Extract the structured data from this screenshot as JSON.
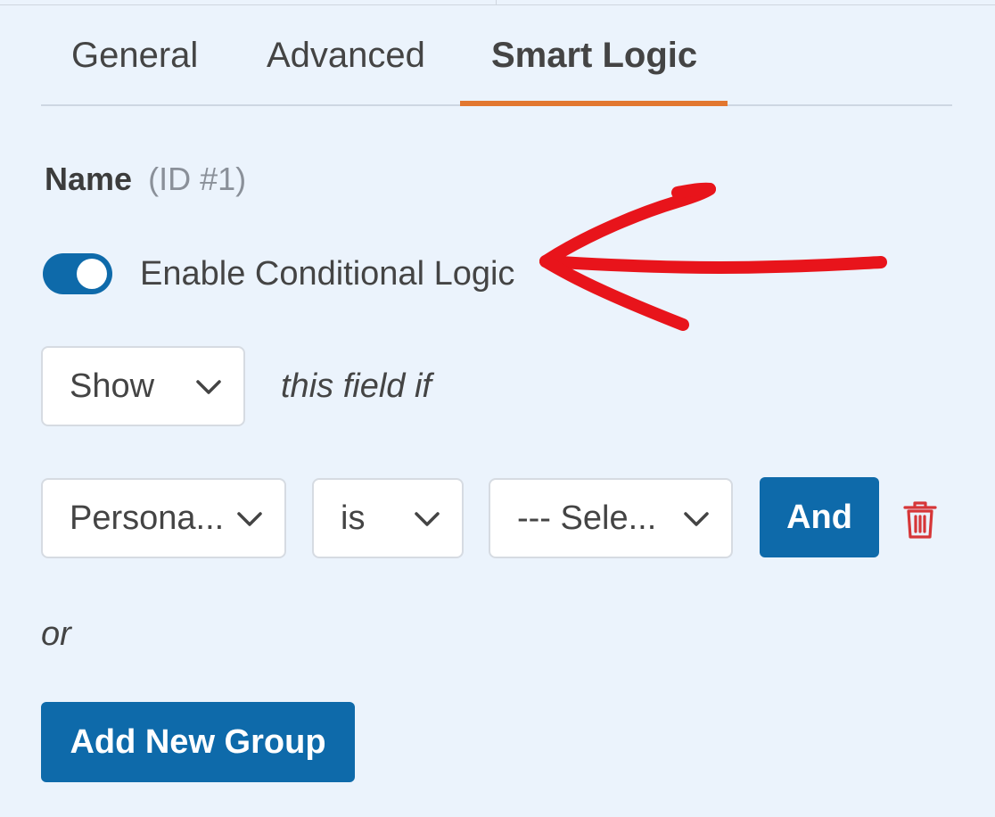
{
  "tabs": [
    {
      "label": "General"
    },
    {
      "label": "Advanced"
    },
    {
      "label": "Smart Logic",
      "active": true
    }
  ],
  "field": {
    "label": "Name",
    "id_text": "(ID #1)"
  },
  "conditional_logic": {
    "toggle_label": "Enable Conditional Logic",
    "enabled": true,
    "action_select": "Show",
    "action_suffix": "this field if",
    "rule": {
      "field_select": "Persona...",
      "operator_select": "is",
      "value_select": "--- Sele..."
    },
    "and_button": "And",
    "or_text": "or",
    "add_group_button": "Add New Group"
  },
  "colors": {
    "background": "#ebf3fc",
    "accent_tab": "#e27730",
    "primary_button": "#0e6aaa",
    "delete_icon": "#d63638",
    "annotation_arrow": "#e8141b"
  },
  "icons": {
    "select_chevron": "chevron-down-icon",
    "delete": "trash-icon",
    "annotation": "red-arrow-annotation"
  }
}
